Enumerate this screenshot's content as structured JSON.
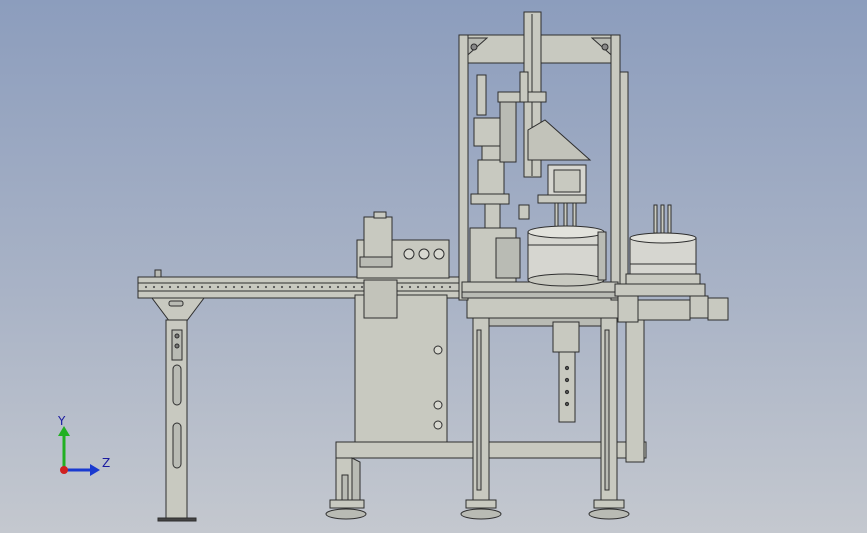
{
  "viewport": {
    "background_top": "#8c9dbd",
    "background_bottom": "#c4c8cf"
  },
  "model": {
    "machine_fill": "#c8c9c0",
    "machine_stroke": "#2e2e2e",
    "steel_fill": "#b9bbb4",
    "drum_fill": "#d6d6d0"
  },
  "triad": {
    "y_label": "Y",
    "z_label": "Z",
    "y_color": "#22b022",
    "z_color": "#1a3ad0",
    "x_color": "#d02020"
  }
}
